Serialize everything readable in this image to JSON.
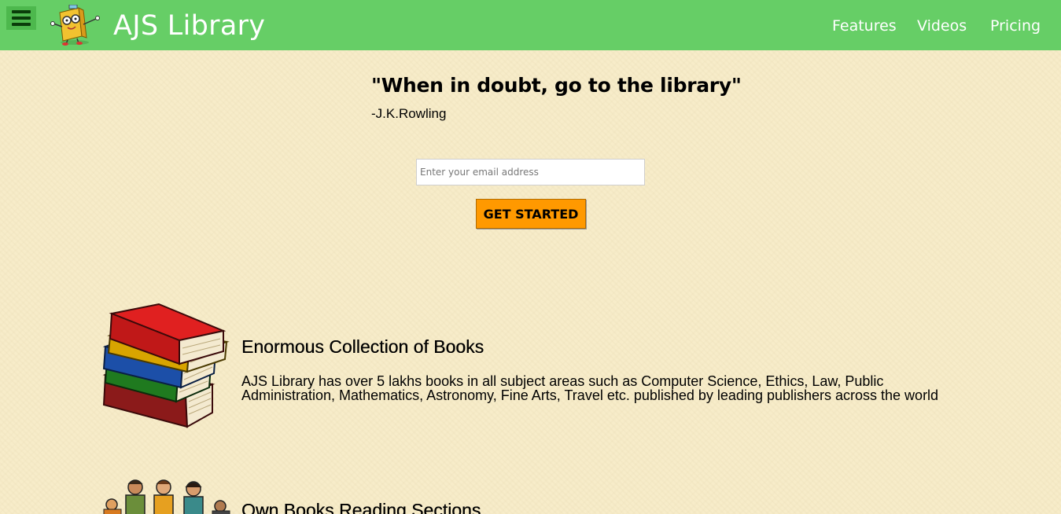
{
  "header": {
    "brand": "AJS Library",
    "nav": [
      {
        "label": "Features"
      },
      {
        "label": "Videos"
      },
      {
        "label": "Pricing"
      }
    ]
  },
  "hero": {
    "quote": "\"When in doubt, go to the library\"",
    "author": "-J.K.Rowling",
    "email_placeholder": "Enter your email address",
    "cta_label": "GET STARTED"
  },
  "features": [
    {
      "title": "Enormous Collection of Books",
      "description": "AJS Library has over 5 lakhs books in all subject areas such as Computer Science, Ethics, Law, Public Administration, Mathematics, Astronomy, Fine Arts, Travel etc. published by leading publishers across the world",
      "icon": "books-stack-icon"
    },
    {
      "title": "Own Books Reading Sections",
      "icon": "readers-group-icon"
    }
  ],
  "colors": {
    "header_bg": "#66ce66",
    "accent": "#ff9900",
    "page_bg": "#f7ecc9"
  }
}
